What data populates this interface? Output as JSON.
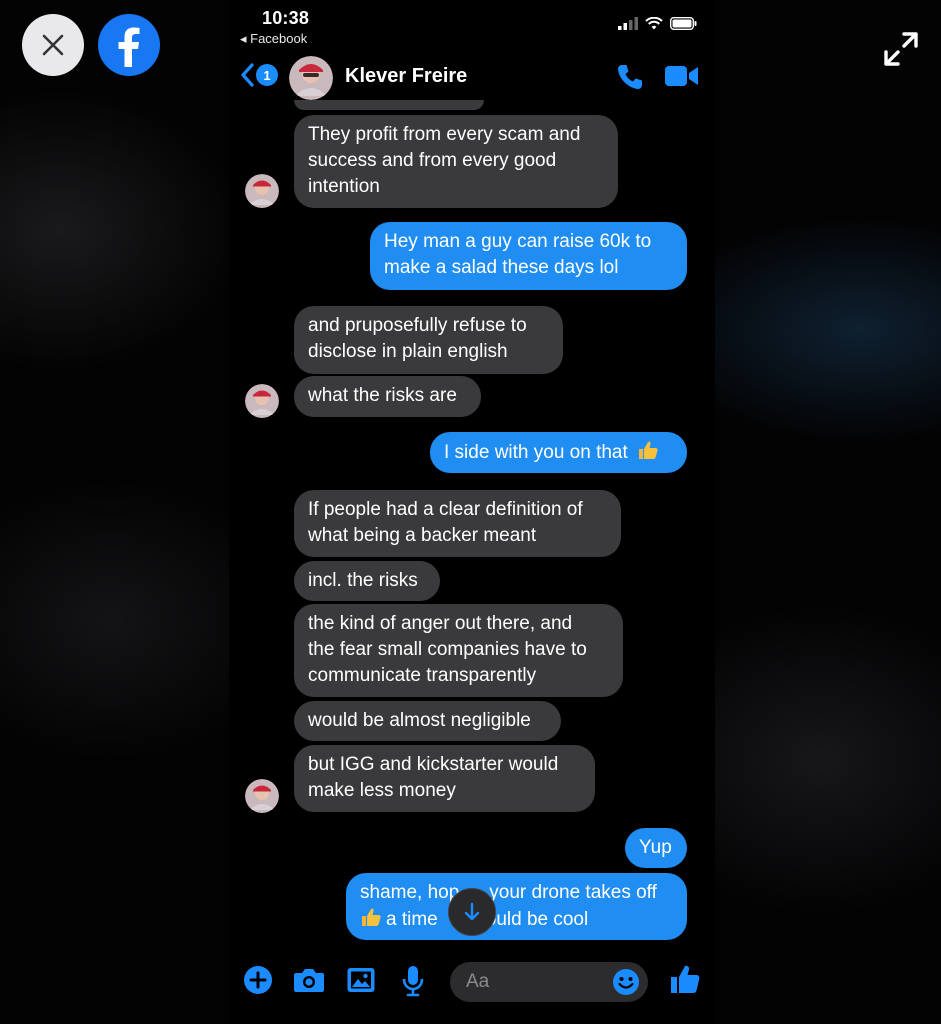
{
  "viewer": {
    "close_icon": "close-icon",
    "app_icon": "facebook-logo",
    "expand_icon": "expand-arrows-icon"
  },
  "status_bar": {
    "time": "10:38",
    "back_app": "◂ Facebook"
  },
  "header": {
    "unread_count": "1",
    "contact_name": "Klever Freire"
  },
  "messages": [
    {
      "side": "in",
      "text": "They profit from every scam and\nsuccess and from every good\nintention"
    },
    {
      "side": "out",
      "text": "Hey man a guy can raise 60k to\nmake a salad these days lol"
    },
    {
      "side": "in",
      "text": "and pruposefully refuse to\ndisclose in plain english"
    },
    {
      "side": "in",
      "text": "what the risks are"
    },
    {
      "side": "out",
      "text": "I side with you on that",
      "emoji": "thumbs-up"
    },
    {
      "side": "in",
      "text": "If people had a clear definition of\nwhat being a backer meant"
    },
    {
      "side": "in",
      "text": "incl. the risks"
    },
    {
      "side": "in",
      "text": "the kind of anger out there, and\nthe fear small companies have to\ncommunicate transparently"
    },
    {
      "side": "in",
      "text": "would be almost negligible"
    },
    {
      "side": "in",
      "text": "but IGG and kickstarter would\nmake less money"
    },
    {
      "side": "out",
      "text": "Yup"
    },
    {
      "side": "out",
      "text_line1": "shame, hop",
      "text_line1b": "your drone takes off",
      "text_line2a": "a time",
      "text_line2b": "ould be cool",
      "emoji": "thumbs-up"
    }
  ],
  "composer": {
    "placeholder": "Aa"
  },
  "colors": {
    "accent": "#1f8df2",
    "incoming_bubble": "#3a3a3c",
    "background": "#000000"
  }
}
